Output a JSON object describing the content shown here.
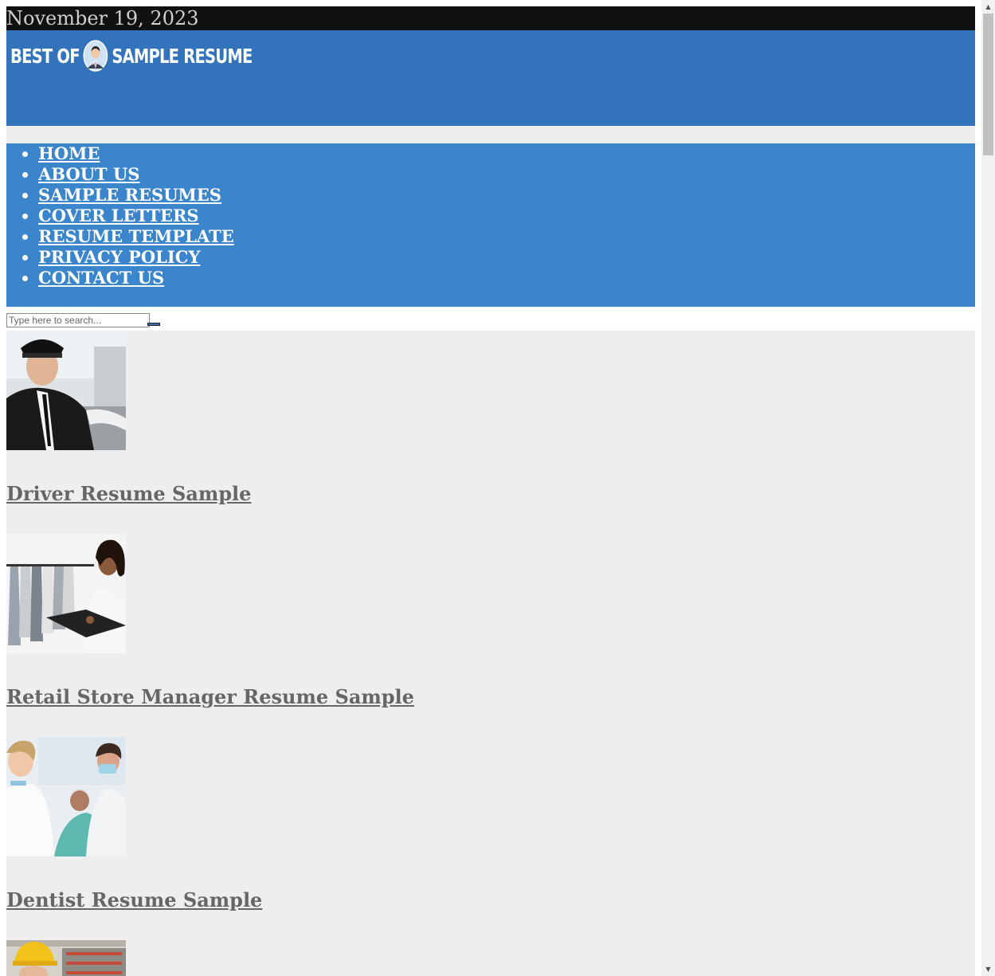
{
  "topbar": {
    "date": "November 19, 2023"
  },
  "header": {
    "logo_left": "BEST OF",
    "logo_right": "SAMPLE RESUME",
    "logo_icon": "person-avatar-icon",
    "background_color": "#3373bb"
  },
  "nav": {
    "background_color": "#3a85cb",
    "items": [
      {
        "label": "HOME"
      },
      {
        "label": "ABOUT US"
      },
      {
        "label": "SAMPLE RESUMES"
      },
      {
        "label": "COVER LETTERS"
      },
      {
        "label": "RESUME TEMPLATE"
      },
      {
        "label": "PRIVACY POLICY"
      },
      {
        "label": "CONTACT US"
      }
    ]
  },
  "search": {
    "placeholder": "Type here to search...",
    "value": "",
    "button_icon": "search-submit-icon"
  },
  "posts": [
    {
      "title": "Driver Resume Sample",
      "image": "chauffeur-photo"
    },
    {
      "title": "Retail Store Manager Resume Sample",
      "image": "retail-manager-photo"
    },
    {
      "title": "Dentist Resume Sample",
      "image": "dentist-photo"
    },
    {
      "title": "",
      "image": "construction-worker-photo"
    }
  ],
  "colors": {
    "page_background": "#eeeeee",
    "topbar_background": "#111111",
    "post_link": "#666666"
  }
}
